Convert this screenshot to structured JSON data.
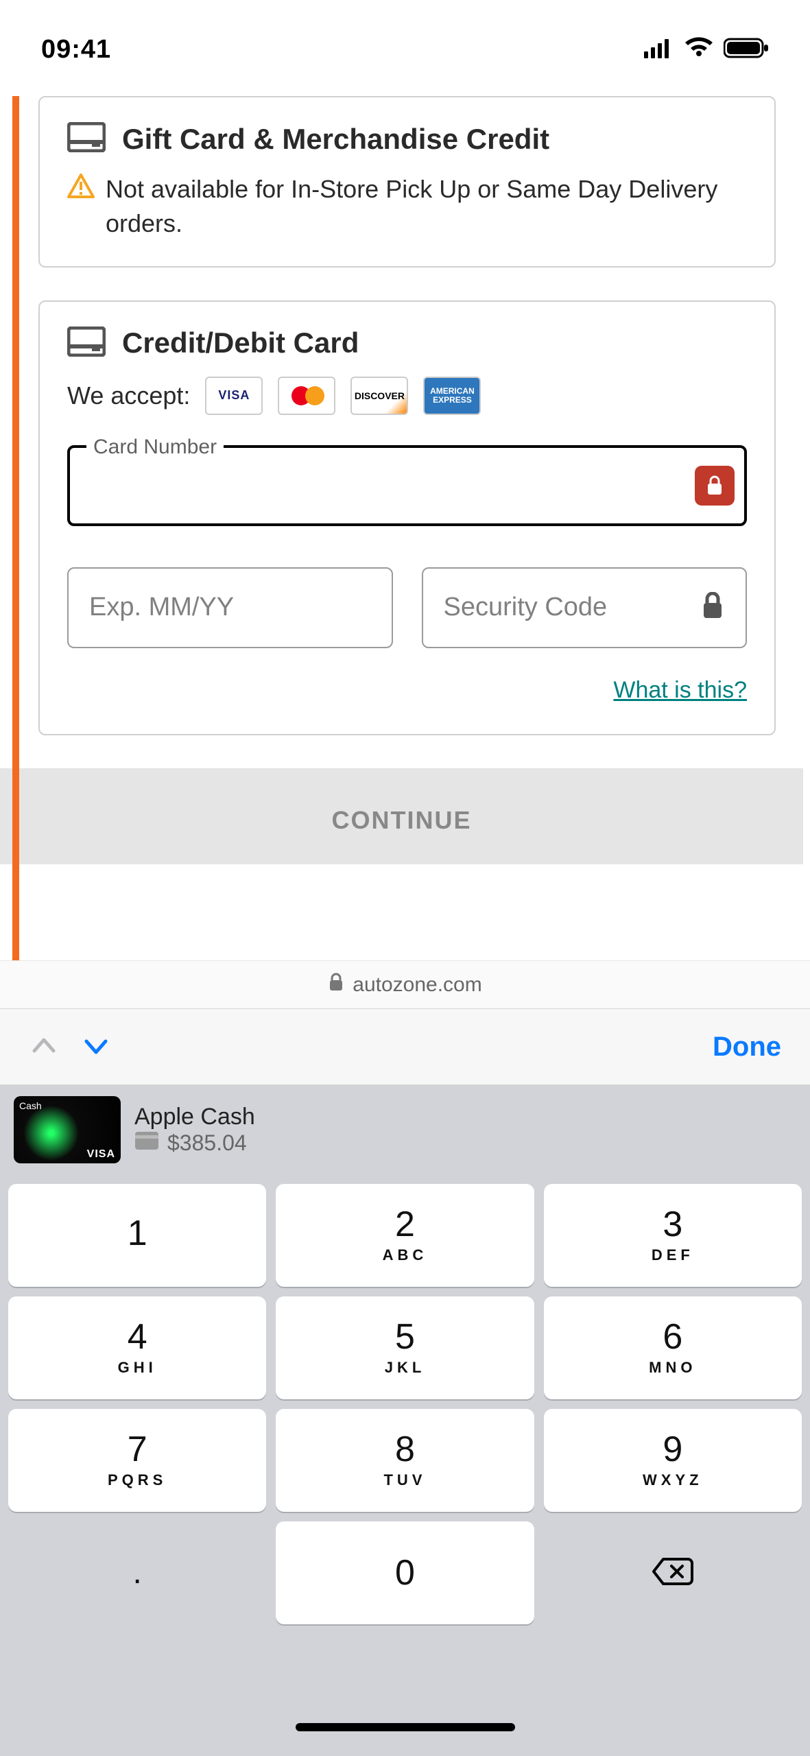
{
  "status": {
    "time": "09:41"
  },
  "gift_card": {
    "title": "Gift Card & Merchandise Credit",
    "warning": "Not available for In-Store Pick Up or Same Day Delivery orders."
  },
  "card_form": {
    "title": "Credit/Debit Card",
    "accept_label": "We accept:",
    "brands": [
      "VISA",
      "mastercard",
      "DISCOVER",
      "AMERICAN EXPRESS"
    ],
    "number_label": "Card Number",
    "number_value": "",
    "exp_placeholder": "Exp. MM/YY",
    "sec_placeholder": "Security Code",
    "what_link": "What is this?"
  },
  "continue_label": "CONTINUE",
  "address_bar": {
    "domain": "autozone.com"
  },
  "accessory": {
    "done": "Done"
  },
  "autofill": {
    "name": "Apple Cash",
    "amount": "$385.04",
    "thumb_corner": "Cash",
    "thumb_brand": "VISA"
  },
  "keypad": {
    "keys": [
      {
        "n": "1",
        "s": ""
      },
      {
        "n": "2",
        "s": "ABC"
      },
      {
        "n": "3",
        "s": "DEF"
      },
      {
        "n": "4",
        "s": "GHI"
      },
      {
        "n": "5",
        "s": "JKL"
      },
      {
        "n": "6",
        "s": "MNO"
      },
      {
        "n": "7",
        "s": "PQRS"
      },
      {
        "n": "8",
        "s": "TUV"
      },
      {
        "n": "9",
        "s": "WXYZ"
      }
    ],
    "dot": ".",
    "zero": "0"
  }
}
